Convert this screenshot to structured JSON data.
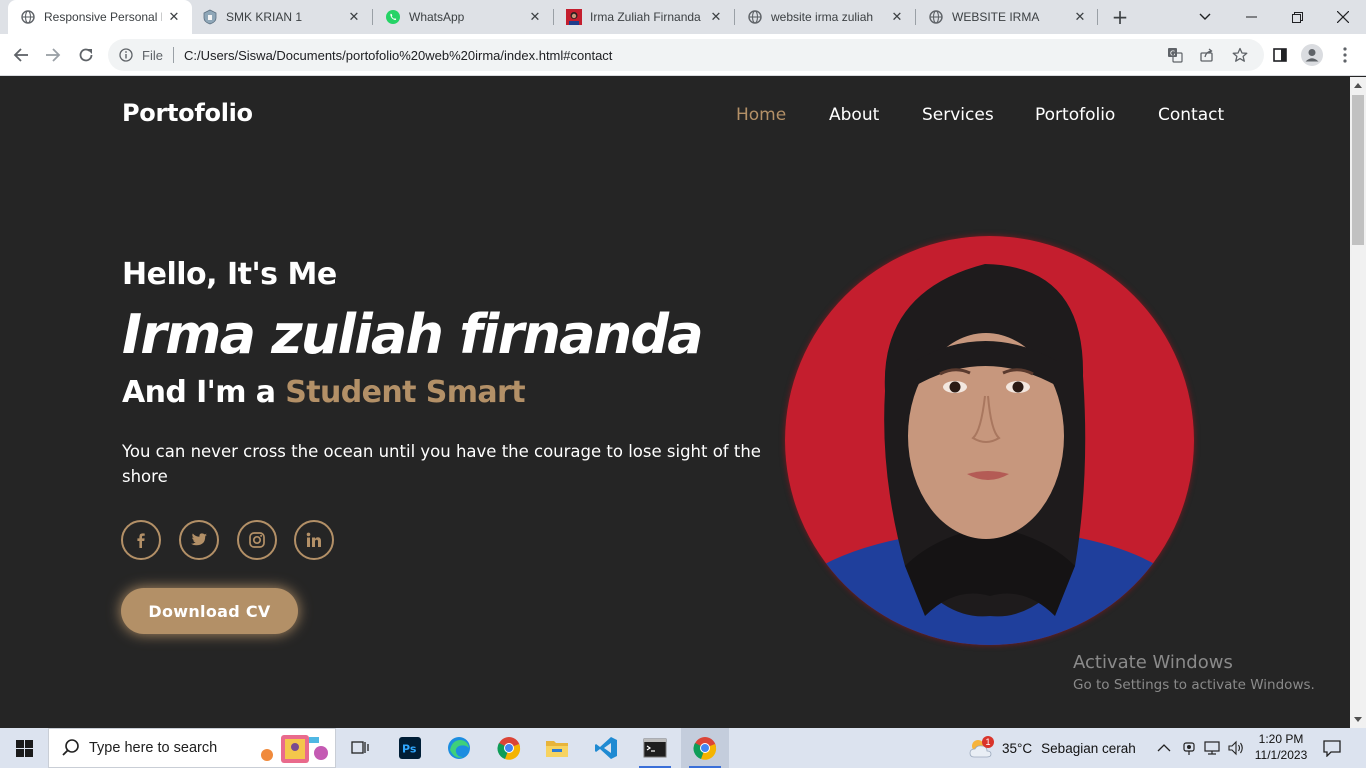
{
  "browser": {
    "tabs": [
      {
        "title": "Responsive Personal Portfolio",
        "favicon": "globe-icon",
        "active": true
      },
      {
        "title": "SMK KRIAN 1",
        "favicon": "school-logo-icon",
        "active": false
      },
      {
        "title": "WhatsApp",
        "favicon": "whatsapp-icon",
        "active": false
      },
      {
        "title": "Irma Zuliah Firnanda",
        "favicon": "profile-photo-icon",
        "active": false
      },
      {
        "title": "website irma zuliah",
        "favicon": "globe-icon",
        "active": false
      },
      {
        "title": "WEBSITE IRMA",
        "favicon": "globe-icon",
        "active": false
      }
    ],
    "address": {
      "scheme_label": "File",
      "url": "C:/Users/Siswa/Documents/portofolio%20web%20irma/index.html#contact"
    }
  },
  "page": {
    "logo": "Portofolio",
    "nav": [
      {
        "label": "Home",
        "active": true
      },
      {
        "label": "About",
        "active": false
      },
      {
        "label": "Services",
        "active": false
      },
      {
        "label": "Portofolio",
        "active": false
      },
      {
        "label": "Contact",
        "active": false
      }
    ],
    "hero": {
      "greeting": "Hello, It's Me",
      "name": "Irma zuliah firnanda",
      "role_prefix": "And I'm a",
      "role_highlight": "Student Smart",
      "quote": "You can never cross the ocean until you have the courage to lose sight of the shore",
      "social": [
        "facebook-icon",
        "twitter-icon",
        "instagram-icon",
        "linkedin-icon"
      ],
      "cta_label": "Download CV"
    },
    "watermark": {
      "line1": "Activate Windows",
      "line2": "Go to Settings to activate Windows."
    }
  },
  "colors": {
    "accent": "#b39067",
    "page_bg": "#252525",
    "photo_bg": "#c41e2e"
  },
  "taskbar": {
    "search_placeholder": "Type here to search",
    "apps": [
      "task-view-icon",
      "photoshop-icon",
      "edge-icon",
      "chrome-icon",
      "file-explorer-icon",
      "vscode-icon",
      "terminal-icon",
      "chrome-icon"
    ],
    "weather": {
      "temp": "35°C",
      "desc": "Sebagian cerah",
      "badge": "1"
    },
    "time": "1:20 PM",
    "date": "11/1/2023"
  }
}
